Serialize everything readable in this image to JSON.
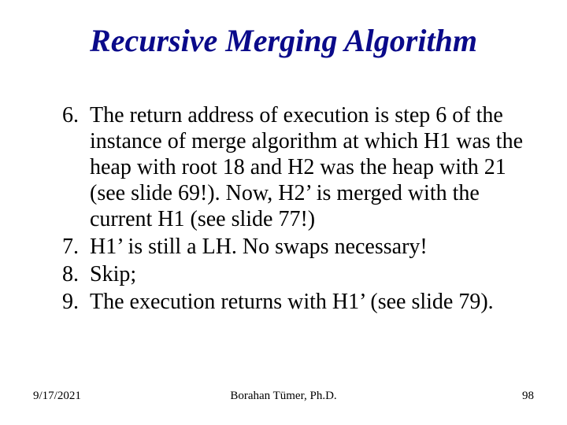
{
  "title": "Recursive Merging Algorithm",
  "items": [
    {
      "n": "6.",
      "t": "The return address of execution is step 6 of the instance of merge algorithm at which H1 was the heap with root 18 and H2 was the heap with 21 (see slide 69!).  Now, H2’ is merged with the current H1 (see slide 77!)"
    },
    {
      "n": "7.",
      "t": "H1’ is still a LH.  No swaps necessary!"
    },
    {
      "n": "8.",
      "t": "Skip;"
    },
    {
      "n": "9.",
      "t": "The execution returns with H1’ (see slide 79)."
    }
  ],
  "footer": {
    "date": "9/17/2021",
    "author": "Borahan Tümer, Ph.D.",
    "page": "98"
  }
}
